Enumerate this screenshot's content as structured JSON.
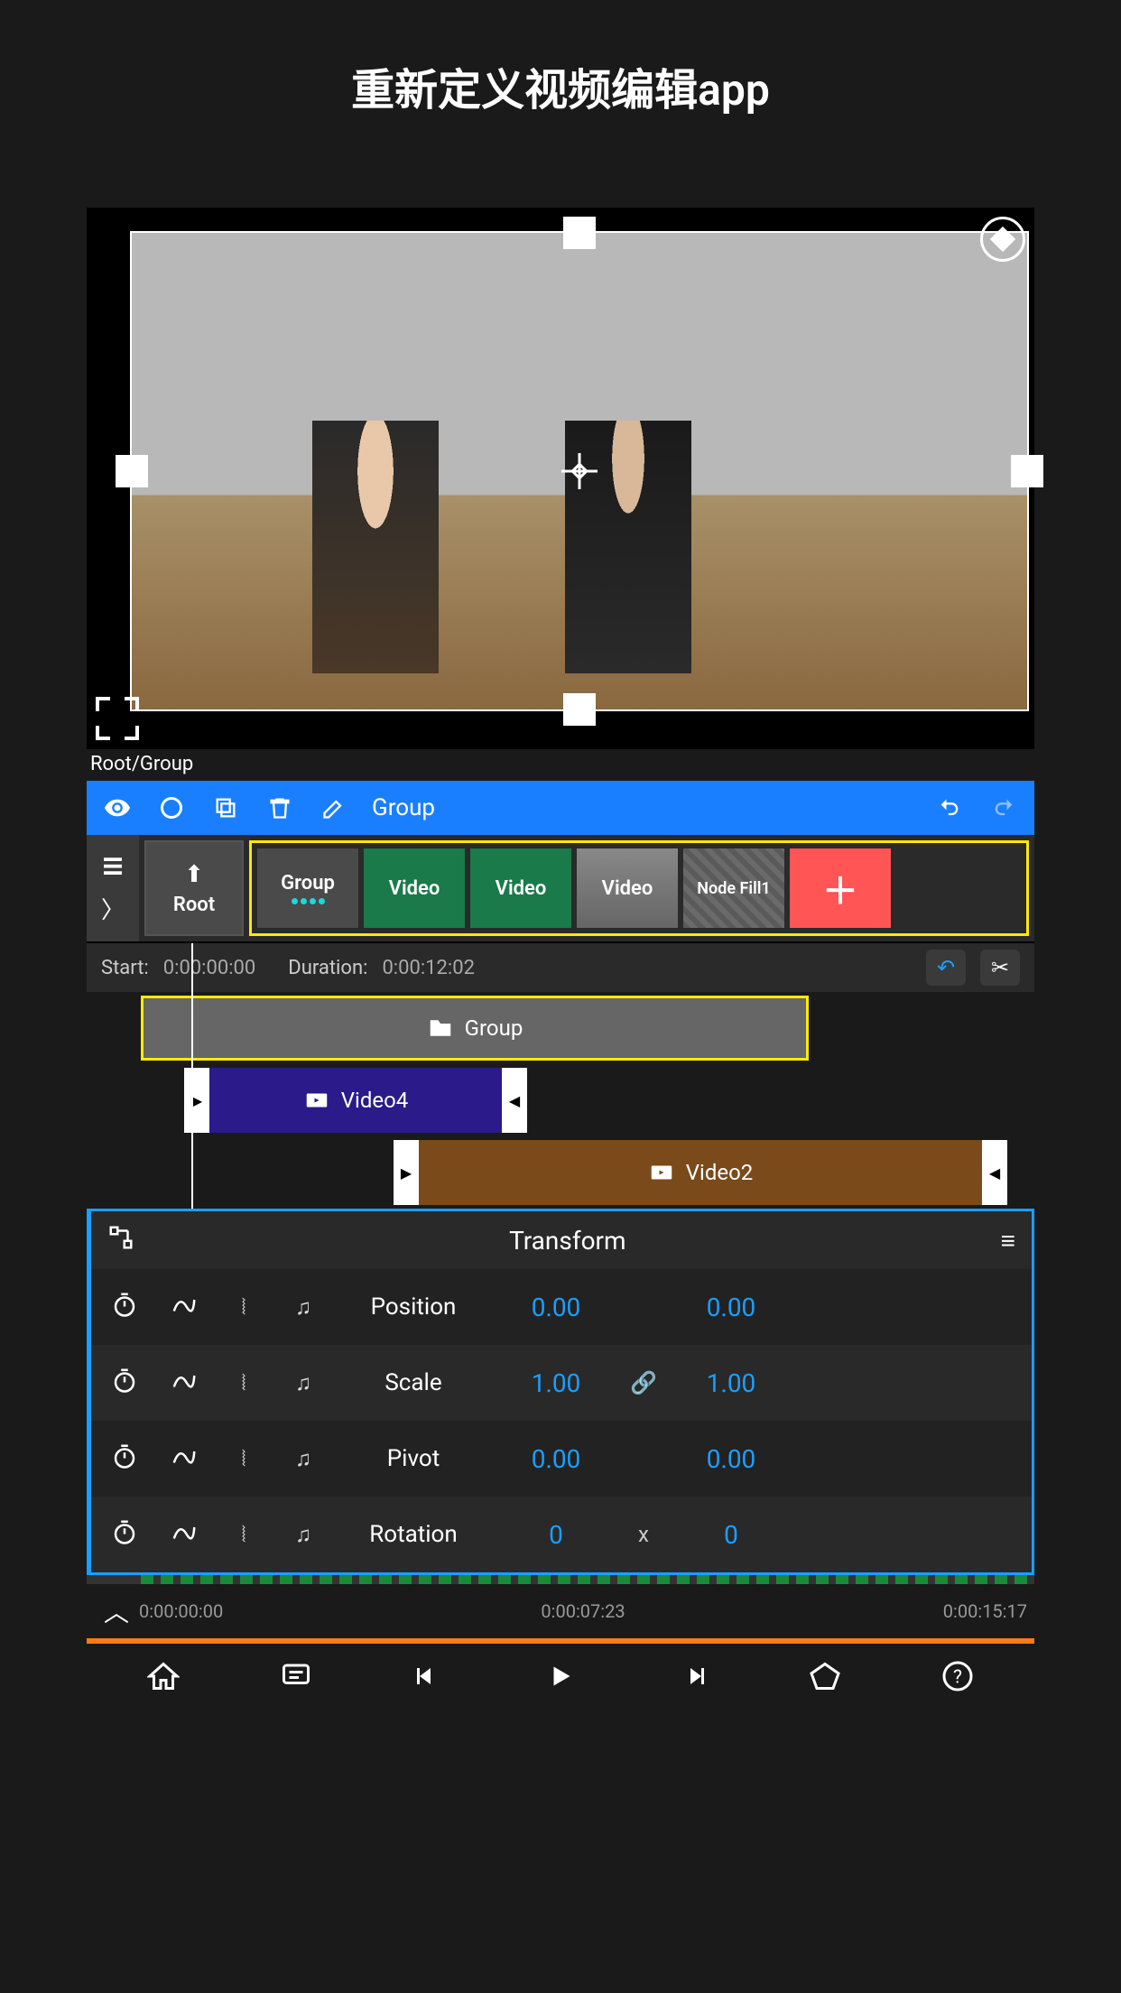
{
  "header": {
    "title": "重新定义视频编辑app"
  },
  "breadcrumb": "Root/Group",
  "toolbar": {
    "label": "Group"
  },
  "root_tile": "Root",
  "clips": {
    "group": "Group",
    "video1": "Video",
    "video2": "Video",
    "video3": "Video",
    "fill": "Node Fill1"
  },
  "timebar": {
    "start_label": "Start:",
    "start_value": "0:00:00:00",
    "duration_label": "Duration:",
    "duration_value": "0:00:12:02"
  },
  "tracks": {
    "group": "Group",
    "video4": "Video4",
    "video2": "Video2"
  },
  "transform": {
    "title": "Transform",
    "rows": [
      {
        "name": "Position",
        "v1": "0.00",
        "sep": "",
        "v2": "0.00"
      },
      {
        "name": "Scale",
        "v1": "1.00",
        "sep": "🔗",
        "v2": "1.00"
      },
      {
        "name": "Pivot",
        "v1": "0.00",
        "sep": "",
        "v2": "0.00"
      },
      {
        "name": "Rotation",
        "v1": "0",
        "sep": "x",
        "v2": "0"
      }
    ]
  },
  "ruler": {
    "t1": "0:00:00:00",
    "t2": "0:00:07:23",
    "t3": "0:00:15:17"
  }
}
